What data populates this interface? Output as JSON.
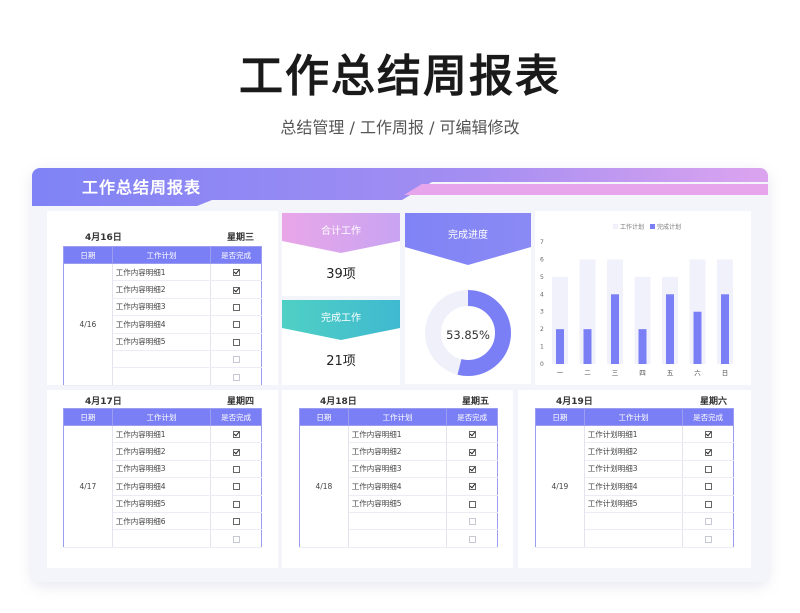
{
  "page": {
    "title": "工作总结周报表",
    "subtitle": "总结管理 / 工作周报 /  可编辑修改"
  },
  "banner": {
    "title": "工作总结周报表"
  },
  "colors": {
    "accent": "#7b7ff5",
    "pink": "#e7a6ec",
    "teal": "#45cbc8",
    "bar_track": "#f1f1fb"
  },
  "table_headers": {
    "date": "日期",
    "plan": "工作计划",
    "done": "是否完成"
  },
  "days": [
    {
      "date_label": "4月16日",
      "weekday": "星期三",
      "date_short": "4/16",
      "tasks": [
        "工作内容明细1",
        "工作内容明细2",
        "工作内容明细3",
        "工作内容明细4",
        "工作内容明细5",
        "",
        ""
      ],
      "done": [
        true,
        true,
        false,
        false,
        false,
        false,
        false
      ]
    },
    {
      "date_label": "4月17日",
      "weekday": "星期四",
      "date_short": "4/17",
      "tasks": [
        "工作内容明细1",
        "工作内容明细2",
        "工作内容明细3",
        "工作内容明细4",
        "工作内容明细5",
        "工作内容明细6",
        ""
      ],
      "done": [
        true,
        true,
        false,
        false,
        false,
        false,
        false
      ]
    },
    {
      "date_label": "4月18日",
      "weekday": "星期五",
      "date_short": "4/18",
      "tasks": [
        "工作内容明细1",
        "工作内容明细2",
        "工作内容明细3",
        "工作内容明细4",
        "工作内容明细5",
        "",
        ""
      ],
      "done": [
        true,
        true,
        true,
        true,
        false,
        false,
        false
      ]
    },
    {
      "date_label": "4月19日",
      "weekday": "星期六",
      "date_short": "4/19",
      "tasks": [
        "工作计划明细1",
        "工作计划明细2",
        "工作计划明细3",
        "工作计划明细4",
        "工作计划明细5",
        "",
        ""
      ],
      "done": [
        true,
        true,
        false,
        false,
        false,
        false,
        false
      ]
    }
  ],
  "stats": {
    "total_label": "合计工作",
    "total_value": "39项",
    "done_label": "完成工作",
    "done_value": "21项",
    "progress_label": "完成进度",
    "progress_value": "53.85%",
    "progress_fraction": 0.5385
  },
  "chart_data": {
    "type": "bar",
    "categories": [
      "一",
      "二",
      "三",
      "四",
      "五",
      "六",
      "日"
    ],
    "series": [
      {
        "name": "工作计划",
        "values": [
          5,
          6,
          6,
          5,
          5,
          6,
          6
        ]
      },
      {
        "name": "完成计划",
        "values": [
          2,
          2,
          4,
          2,
          4,
          3,
          4
        ]
      }
    ],
    "ylim": [
      0,
      7
    ],
    "yticks": [
      0,
      1,
      2,
      3,
      4,
      5,
      6,
      7
    ],
    "legend": "top-center",
    "grid": false
  }
}
